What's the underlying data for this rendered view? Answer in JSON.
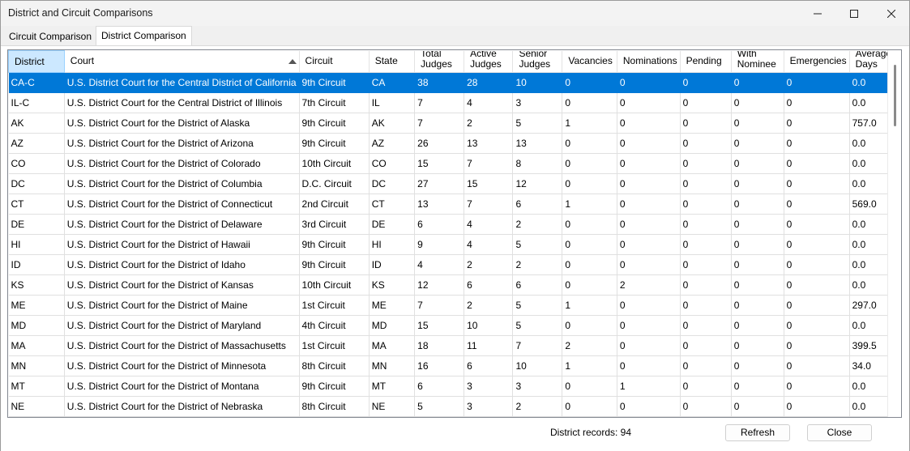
{
  "window": {
    "title": "District and Circuit Comparisons"
  },
  "tabs": [
    {
      "label": "Circuit Comparison"
    },
    {
      "label": "District Comparison"
    }
  ],
  "table": {
    "columns": [
      {
        "label": "District"
      },
      {
        "label": "Court"
      },
      {
        "label": "Circuit"
      },
      {
        "label": "State"
      },
      {
        "label": "Total",
        "label2": "Judges"
      },
      {
        "label": "Active",
        "label2": "Judges"
      },
      {
        "label": "Senior",
        "label2": "Judges"
      },
      {
        "label": "Vacancies"
      },
      {
        "label": "Nominations"
      },
      {
        "label": "Pending"
      },
      {
        "label": "With",
        "label2": "Nominee"
      },
      {
        "label": "Emergencies"
      },
      {
        "label": "Average",
        "label2": "Days"
      }
    ],
    "rows": [
      [
        "CA-C",
        "U.S. District Court for the Central District of California",
        "9th Circuit",
        "CA",
        "38",
        "28",
        "10",
        "0",
        "0",
        "0",
        "0",
        "0",
        "0.0"
      ],
      [
        "IL-C",
        "U.S. District Court for the Central District of Illinois",
        "7th Circuit",
        "IL",
        "7",
        "4",
        "3",
        "0",
        "0",
        "0",
        "0",
        "0",
        "0.0"
      ],
      [
        "AK",
        "U.S. District Court for the District of Alaska",
        "9th Circuit",
        "AK",
        "7",
        "2",
        "5",
        "1",
        "0",
        "0",
        "0",
        "0",
        "757.0"
      ],
      [
        "AZ",
        "U.S. District Court for the District of Arizona",
        "9th Circuit",
        "AZ",
        "26",
        "13",
        "13",
        "0",
        "0",
        "0",
        "0",
        "0",
        "0.0"
      ],
      [
        "CO",
        "U.S. District Court for the District of Colorado",
        "10th Circuit",
        "CO",
        "15",
        "7",
        "8",
        "0",
        "0",
        "0",
        "0",
        "0",
        "0.0"
      ],
      [
        "DC",
        "U.S. District Court for the District of Columbia",
        "D.C. Circuit",
        "DC",
        "27",
        "15",
        "12",
        "0",
        "0",
        "0",
        "0",
        "0",
        "0.0"
      ],
      [
        "CT",
        "U.S. District Court for the District of Connecticut",
        "2nd Circuit",
        "CT",
        "13",
        "7",
        "6",
        "1",
        "0",
        "0",
        "0",
        "0",
        "569.0"
      ],
      [
        "DE",
        "U.S. District Court for the District of Delaware",
        "3rd Circuit",
        "DE",
        "6",
        "4",
        "2",
        "0",
        "0",
        "0",
        "0",
        "0",
        "0.0"
      ],
      [
        "HI",
        "U.S. District Court for the District of Hawaii",
        "9th Circuit",
        "HI",
        "9",
        "4",
        "5",
        "0",
        "0",
        "0",
        "0",
        "0",
        "0.0"
      ],
      [
        "ID",
        "U.S. District Court for the District of Idaho",
        "9th Circuit",
        "ID",
        "4",
        "2",
        "2",
        "0",
        "0",
        "0",
        "0",
        "0",
        "0.0"
      ],
      [
        "KS",
        "U.S. District Court for the District of Kansas",
        "10th Circuit",
        "KS",
        "12",
        "6",
        "6",
        "0",
        "2",
        "0",
        "0",
        "0",
        "0.0"
      ],
      [
        "ME",
        "U.S. District Court for the District of Maine",
        "1st Circuit",
        "ME",
        "7",
        "2",
        "5",
        "1",
        "0",
        "0",
        "0",
        "0",
        "297.0"
      ],
      [
        "MD",
        "U.S. District Court for the District of Maryland",
        "4th Circuit",
        "MD",
        "15",
        "10",
        "5",
        "0",
        "0",
        "0",
        "0",
        "0",
        "0.0"
      ],
      [
        "MA",
        "U.S. District Court for the District of Massachusetts",
        "1st Circuit",
        "MA",
        "18",
        "11",
        "7",
        "2",
        "0",
        "0",
        "0",
        "0",
        "399.5"
      ],
      [
        "MN",
        "U.S. District Court for the District of Minnesota",
        "8th Circuit",
        "MN",
        "16",
        "6",
        "10",
        "1",
        "0",
        "0",
        "0",
        "0",
        "34.0"
      ],
      [
        "MT",
        "U.S. District Court for the District of Montana",
        "9th Circuit",
        "MT",
        "6",
        "3",
        "3",
        "0",
        "1",
        "0",
        "0",
        "0",
        "0.0"
      ],
      [
        "NE",
        "U.S. District Court for the District of Nebraska",
        "8th Circuit",
        "NE",
        "5",
        "3",
        "2",
        "0",
        "0",
        "0",
        "0",
        "0",
        "0.0"
      ]
    ]
  },
  "footer": {
    "records_label": "District records: 94",
    "refresh_label": "Refresh",
    "close_label": "Close"
  }
}
